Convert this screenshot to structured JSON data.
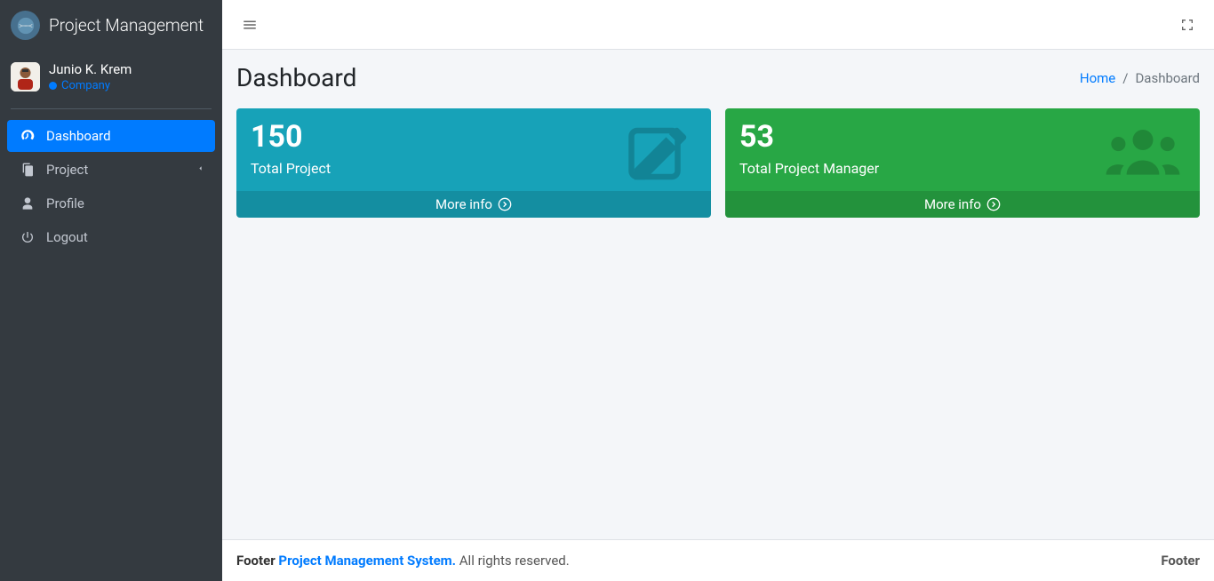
{
  "brand": {
    "text": "Project Management"
  },
  "user": {
    "name": "Junio K. Krem",
    "role": "Company"
  },
  "sidebar": {
    "items": [
      {
        "label": "Dashboard"
      },
      {
        "label": "Project"
      },
      {
        "label": "Profile"
      },
      {
        "label": "Logout"
      }
    ]
  },
  "page": {
    "title": "Dashboard"
  },
  "breadcrumb": {
    "home": "Home",
    "current": "Dashboard"
  },
  "cards": {
    "project": {
      "value": "150",
      "label": "Total Project",
      "more": "More info"
    },
    "manager": {
      "value": "53",
      "label": "Total Project Manager",
      "more": "More info"
    }
  },
  "footer": {
    "prefix": "Footer",
    "link": "Project Management System.",
    "rights": "All rights reserved.",
    "right": "Footer"
  }
}
